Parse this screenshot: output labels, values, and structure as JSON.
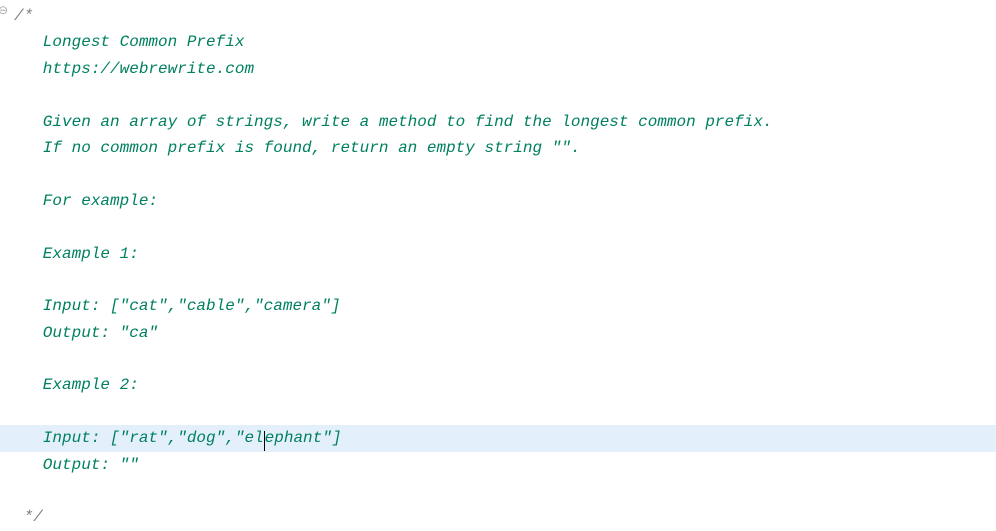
{
  "editor": {
    "gutter_icon": "⊖",
    "comment_open": "/*",
    "lines": [
      "   Longest Common Prefix",
      "   https://webrewrite.com",
      "",
      "   Given an array of strings, write a method to find the longest common prefix.",
      "   If no common prefix is found, return an empty string \"\".",
      "",
      "   For example:",
      "",
      "   Example 1:",
      "",
      "   Input: [\"cat\",\"cable\",\"camera\"]",
      "   Output: \"ca\"",
      "",
      "   Example 2:",
      "",
      "   Input: [\"rat\",\"dog\",\"elephant\"]",
      "   Output: \"\"",
      ""
    ],
    "comment_close": " */",
    "highlighted_index": 15,
    "cursor": {
      "line_index": 15,
      "before": "   Input: [\"rat\",\"dog\",\"el",
      "after": "ephant\"]"
    }
  }
}
